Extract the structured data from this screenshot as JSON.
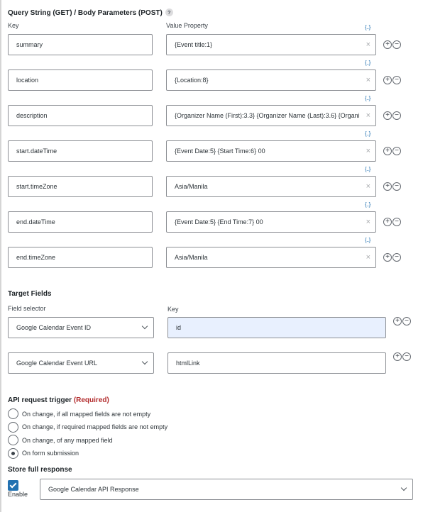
{
  "query_section": {
    "title": "Query String (GET) / Body Parameters (POST)",
    "help_icon": "?",
    "key_header": "Key",
    "value_header": "Value Property",
    "merge_tag_glyph": "{..}",
    "clear_glyph": "×",
    "add_glyph": "+",
    "remove_glyph": "−",
    "rows": [
      {
        "key": "summary",
        "value": "{Event title:1}"
      },
      {
        "key": "location",
        "value": "{Location:8}"
      },
      {
        "key": "description",
        "value": "{Organizer Name (First):3.3} {Organizer Name (Last):3.6} {Organi"
      },
      {
        "key": "start.dateTime",
        "value": "{Event Date:5} {Start Time:6} 00"
      },
      {
        "key": "start.timeZone",
        "value": "Asia/Manila"
      },
      {
        "key": "end.dateTime",
        "value": "{Event Date:5} {End Time:7} 00"
      },
      {
        "key": "end.timeZone",
        "value": "Asia/Manila"
      }
    ]
  },
  "target_fields": {
    "title": "Target Fields",
    "selector_header": "Field selector",
    "key_header": "Key",
    "rows": [
      {
        "selector": "Google Calendar Event ID",
        "key": "id"
      },
      {
        "selector": "Google Calendar Event URL",
        "key": "htmlLink"
      }
    ]
  },
  "api_trigger": {
    "title": "API request trigger",
    "required_label": "(Required)",
    "options": [
      {
        "label": "On change, if all mapped fields are not empty",
        "checked": false
      },
      {
        "label": "On change, if required mapped fields are not empty",
        "checked": false
      },
      {
        "label": "On change, of any mapped field",
        "checked": false
      },
      {
        "label": "On form submission",
        "checked": true
      }
    ]
  },
  "store_response": {
    "title": "Store full response",
    "enable_label": "Enable",
    "enabled": true,
    "selected": "Google Calendar API Response"
  },
  "colors": {
    "accent": "#2271b1",
    "required": "#b32d2e",
    "focused_input_bg": "#e8f0fe"
  }
}
